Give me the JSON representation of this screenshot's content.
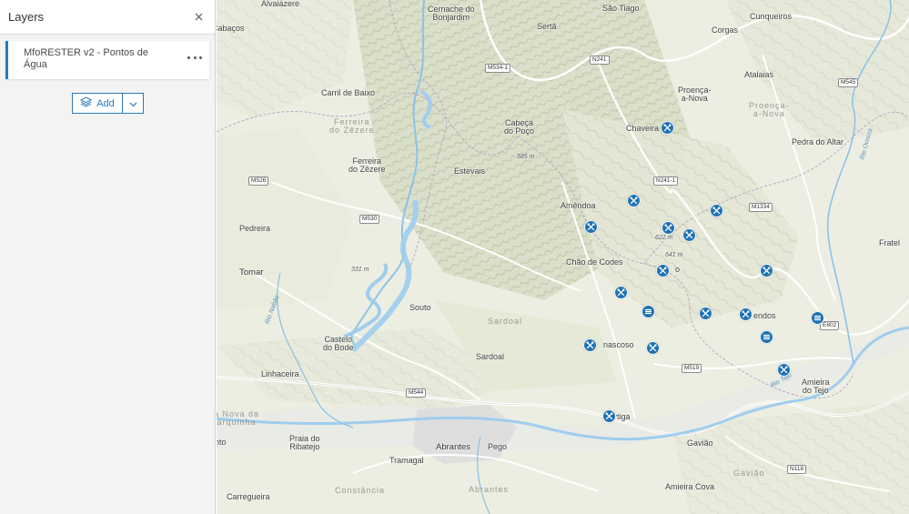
{
  "panel": {
    "title": "Layers",
    "close_icon": "close-icon",
    "layer": {
      "title": "MfoRESTER v2 - Pontos de Água",
      "menu_icon": "ellipsis-icon"
    },
    "add": {
      "label": "Add",
      "icon": "layers-add-icon",
      "dropdown_icon": "chevron-down-icon"
    }
  },
  "map": {
    "labels": [
      {
        "text": "Alvaiázere",
        "cls": "big"
      },
      {
        "text": "Cernache do\nBonjardim",
        "cls": "big"
      },
      {
        "text": "São Tiago",
        "cls": "big"
      },
      {
        "text": "Cunqueiros",
        "cls": "big"
      },
      {
        "text": "Cabaços",
        "cls": "big"
      },
      {
        "text": "Sertã",
        "cls": "big"
      },
      {
        "text": "Corgas",
        "cls": "big"
      },
      {
        "text": "Atalaias",
        "cls": "big"
      },
      {
        "text": "Carril de Baixo",
        "cls": "big"
      },
      {
        "text": "Proença-\na-Nova",
        "cls": "big"
      },
      {
        "text": "Proença-\na-Nova",
        "cls": "region"
      },
      {
        "text": "Ferreira\ndo Zêzere",
        "cls": "region"
      },
      {
        "text": "Cabeça\ndo Poço",
        "cls": "big"
      },
      {
        "text": "Chaveira",
        "cls": "big"
      },
      {
        "text": "Pedra do Altar",
        "cls": "big"
      },
      {
        "text": "Ferreira\ndo Zêzere",
        "cls": "big"
      },
      {
        "text": "585 m",
        "cls": "elev"
      },
      {
        "text": "Estevais",
        "cls": "big"
      },
      {
        "text": "Amêndoa",
        "cls": "big"
      },
      {
        "text": "Pedreira",
        "cls": "big"
      },
      {
        "text": "622 m",
        "cls": "elev"
      },
      {
        "text": "641 m",
        "cls": "elev"
      },
      {
        "text": "Fratel",
        "cls": "big"
      },
      {
        "text": "Tomar",
        "cls": "city"
      },
      {
        "text": "331 m",
        "cls": "elev"
      },
      {
        "text": "Chão de Codes",
        "cls": "big"
      },
      {
        "text": "M",
        "cls": "big"
      },
      {
        "text": "o",
        "cls": "big"
      },
      {
        "text": "Souto",
        "cls": "big"
      },
      {
        "text": "Sardoal",
        "cls": "region"
      },
      {
        "text": "endos",
        "cls": "big"
      },
      {
        "text": "Castelo\ndo Bode",
        "cls": "big"
      },
      {
        "text": "nascoso",
        "cls": "big"
      },
      {
        "text": "Sardoal",
        "cls": "big"
      },
      {
        "text": "Linhaceira",
        "cls": "big"
      },
      {
        "text": "Amieira\ndo Tejo",
        "cls": "big"
      },
      {
        "text": "a Nova da\narquinha",
        "cls": "region"
      },
      {
        "text": "rtiga",
        "cls": "big"
      },
      {
        "text": "nto",
        "cls": "big"
      },
      {
        "text": "Praia do\nRibatejo",
        "cls": "big"
      },
      {
        "text": "Abrantes",
        "cls": "city"
      },
      {
        "text": "Pego",
        "cls": "big"
      },
      {
        "text": "Gavião",
        "cls": "big"
      },
      {
        "text": "Tramagal",
        "cls": "big"
      },
      {
        "text": "Gavião",
        "cls": "region"
      },
      {
        "text": "Constância",
        "cls": "region"
      },
      {
        "text": "Abrantes",
        "cls": "region"
      },
      {
        "text": "Carregueira",
        "cls": "big"
      },
      {
        "text": "Amieira Cova",
        "cls": "big"
      },
      {
        "text": "Rio Nabão",
        "cls": "river"
      },
      {
        "text": "Rio Tejo",
        "cls": "river"
      },
      {
        "text": "Rio Ocreza",
        "cls": "river"
      }
    ],
    "shields": [
      "M534-1",
      "N241",
      "M545",
      "N241-1",
      "M526",
      "M1334",
      "M530",
      "E802",
      "M519",
      "M544",
      "N118"
    ],
    "markers": [
      {
        "icon": "tools"
      },
      {
        "icon": "tools"
      },
      {
        "icon": "tools"
      },
      {
        "icon": "tools"
      },
      {
        "icon": "tools"
      },
      {
        "icon": "tools"
      },
      {
        "icon": "tools"
      },
      {
        "icon": "tools"
      },
      {
        "icon": "tank"
      },
      {
        "icon": "tools"
      },
      {
        "icon": "tools"
      },
      {
        "icon": "tank"
      },
      {
        "icon": "tank"
      },
      {
        "icon": "tools"
      },
      {
        "icon": "tools"
      },
      {
        "icon": "tools"
      },
      {
        "icon": "tools"
      },
      {
        "icon": "tools"
      }
    ]
  }
}
